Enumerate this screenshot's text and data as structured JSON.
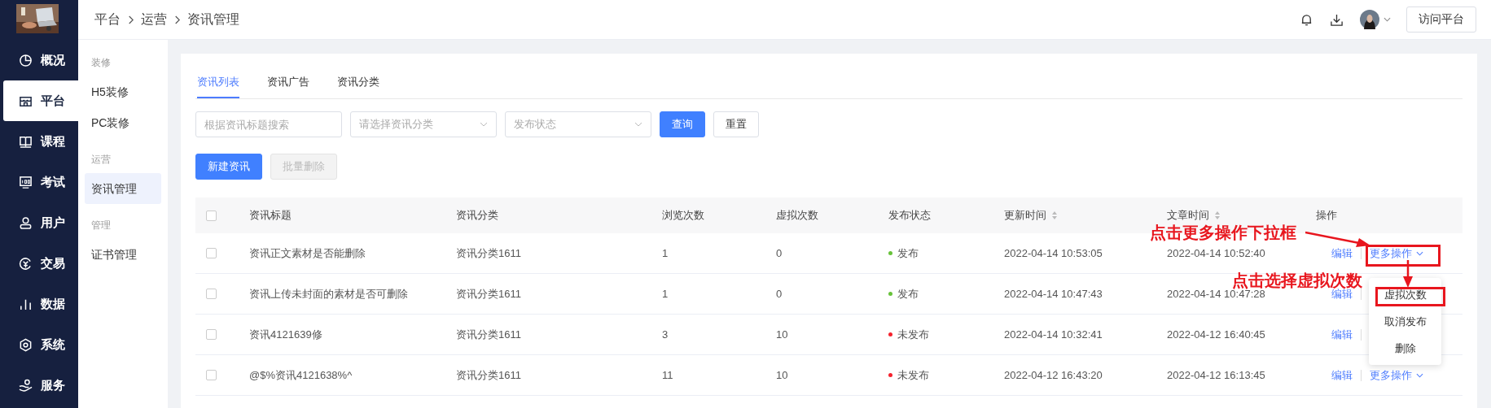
{
  "nav": [
    {
      "label": "概况",
      "kind": "pie",
      "selected": false
    },
    {
      "label": "平台",
      "kind": "shop",
      "selected": true
    },
    {
      "label": "课程",
      "kind": "book",
      "selected": false
    },
    {
      "label": "考试",
      "kind": "monitor",
      "selected": false
    },
    {
      "label": "用户",
      "kind": "user",
      "selected": false
    },
    {
      "label": "交易",
      "kind": "coin",
      "selected": false
    },
    {
      "label": "数据",
      "kind": "bars",
      "selected": false
    },
    {
      "label": "系统",
      "kind": "gear",
      "selected": false
    },
    {
      "label": "服务",
      "kind": "hand",
      "selected": false
    }
  ],
  "breadcrumb": [
    "平台",
    "运营",
    "资讯管理"
  ],
  "header": {
    "button": "访问平台"
  },
  "subnav": [
    {
      "title": "装修",
      "items": [
        {
          "label": "H5装修",
          "selected": false
        },
        {
          "label": "PC装修",
          "selected": false
        }
      ]
    },
    {
      "title": "运营",
      "items": [
        {
          "label": "资讯管理",
          "selected": true
        }
      ]
    },
    {
      "title": "管理",
      "items": [
        {
          "label": "证书管理",
          "selected": false
        }
      ]
    }
  ],
  "tabs": [
    {
      "label": "资讯列表",
      "selected": true
    },
    {
      "label": "资讯广告",
      "selected": false
    },
    {
      "label": "资讯分类",
      "selected": false
    }
  ],
  "filters": {
    "search": {
      "placeholder": "根据资讯标题搜索"
    },
    "category": {
      "placeholder": "请选择资讯分类"
    },
    "status": {
      "placeholder": "发布状态"
    },
    "query": "查询",
    "reset": "重置"
  },
  "actions": [
    {
      "label": "新建资讯",
      "disabled": false
    },
    {
      "label": "批量删除",
      "disabled": true
    }
  ],
  "table": {
    "header_checked": false,
    "columns": [
      {
        "label": "资讯标题",
        "sortable": false
      },
      {
        "label": "资讯分类",
        "sortable": false
      },
      {
        "label": "浏览次数",
        "sortable": false
      },
      {
        "label": "虚拟次数",
        "sortable": false
      },
      {
        "label": "发布状态",
        "sortable": false
      },
      {
        "label": "更新时间",
        "sortable": true
      },
      {
        "label": "文章时间",
        "sortable": true
      },
      {
        "label": "操作",
        "sortable": false
      }
    ],
    "rows": [
      {
        "checked": false,
        "title": "资讯正文素材是否能删除",
        "category": "资讯分类1611",
        "views": "1",
        "virtual": "0",
        "status": {
          "label": "发布",
          "color": "#67c23a"
        },
        "updated": "2022-04-14 10:53:05",
        "article_time": "2022-04-14 10:52:40",
        "edit": "编辑",
        "more": "更多操作"
      },
      {
        "checked": false,
        "title": "资讯上传未封面的素材是否可删除",
        "category": "资讯分类1611",
        "views": "1",
        "virtual": "0",
        "status": {
          "label": "发布",
          "color": "#67c23a"
        },
        "updated": "2022-04-14 10:47:43",
        "article_time": "2022-04-14 10:47:28",
        "edit": "编辑"
      },
      {
        "checked": false,
        "title": "资讯4121639修",
        "category": "资讯分类1611",
        "views": "3",
        "virtual": "10",
        "status": {
          "label": "未发布",
          "color": "#f5222d"
        },
        "updated": "2022-04-14 10:32:41",
        "article_time": "2022-04-12 16:40:45",
        "edit": "编辑"
      },
      {
        "checked": false,
        "title": "@$%资讯4121638%^",
        "category": "资讯分类1611",
        "views": "11",
        "virtual": "10",
        "status": {
          "label": "未发布",
          "color": "#f5222d"
        },
        "updated": "2022-04-12 16:43:20",
        "article_time": "2022-04-12 16:13:45",
        "edit": "编辑",
        "more": "更多操作"
      }
    ]
  },
  "dropdown": {
    "items": [
      "虚拟次数",
      "取消发布",
      "删除"
    ]
  },
  "callouts": [
    {
      "text": "点击更多操作下拉框"
    },
    {
      "text": "点击选择虚拟次数"
    }
  ]
}
